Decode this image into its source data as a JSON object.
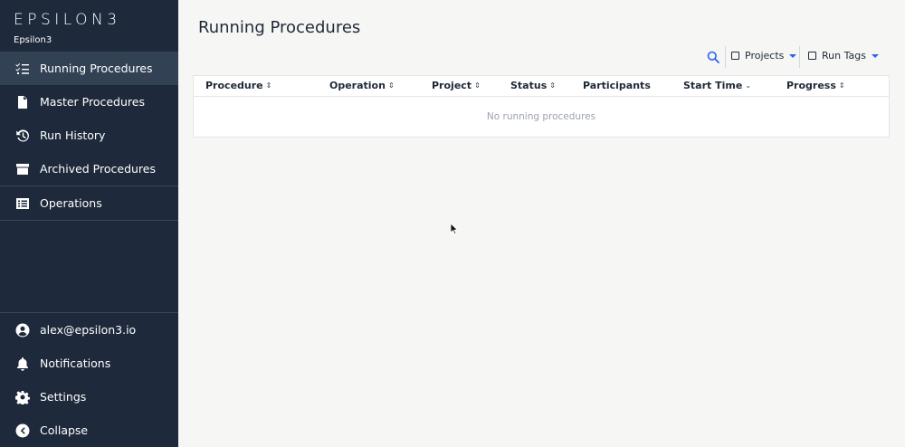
{
  "sidebar": {
    "logo": "EPSILON3",
    "org": "Epsilon3",
    "items": [
      {
        "label": "Running Procedures",
        "icon": "checklist-icon",
        "active": true
      },
      {
        "label": "Master Procedures",
        "icon": "document-icon"
      },
      {
        "label": "Run History",
        "icon": "history-icon"
      },
      {
        "label": "Archived Procedures",
        "icon": "archive-icon"
      },
      {
        "label": "Operations",
        "icon": "list-icon"
      }
    ],
    "bottom": [
      {
        "label": "alex@epsilon3.io",
        "icon": "user-circle-icon"
      },
      {
        "label": "Notifications",
        "icon": "bell-icon"
      },
      {
        "label": "Settings",
        "icon": "gear-icon"
      },
      {
        "label": "Collapse",
        "icon": "chevron-left-circle-icon"
      }
    ]
  },
  "main": {
    "title": "Running Procedures",
    "filters": {
      "projects": "Projects",
      "run_tags": "Run Tags"
    },
    "table": {
      "columns": [
        "Procedure",
        "Operation",
        "Project",
        "Status",
        "Participants",
        "Start Time",
        "Progress"
      ],
      "empty_text": "No running procedures"
    }
  },
  "colors": {
    "sidebar_bg": "#1e293b",
    "sidebar_active": "#334155",
    "accent": "#2563eb",
    "page_bg": "#f6f7f5"
  }
}
